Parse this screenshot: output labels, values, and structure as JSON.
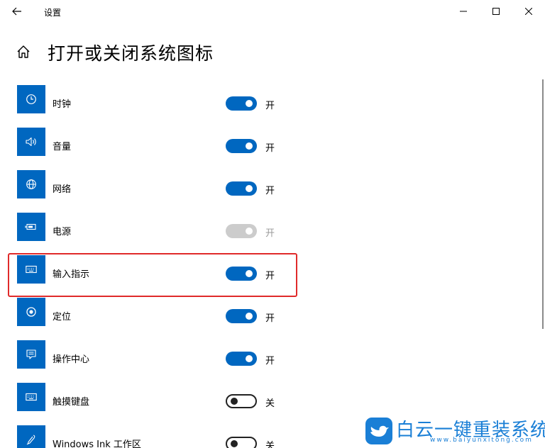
{
  "window": {
    "title": "设置"
  },
  "page": {
    "title": "打开或关闭系统图标"
  },
  "items": [
    {
      "label": "时钟",
      "icon": "clock-icon",
      "state": "on",
      "state_label": "开"
    },
    {
      "label": "音量",
      "icon": "volume-icon",
      "state": "on",
      "state_label": "开"
    },
    {
      "label": "网络",
      "icon": "globe-icon",
      "state": "on",
      "state_label": "开"
    },
    {
      "label": "电源",
      "icon": "battery-icon",
      "state": "disabled",
      "state_label": "开"
    },
    {
      "label": "输入指示",
      "icon": "keyboard-icon",
      "state": "on",
      "state_label": "开"
    },
    {
      "label": "定位",
      "icon": "location-icon",
      "state": "on",
      "state_label": "开"
    },
    {
      "label": "操作中心",
      "icon": "action-center-icon",
      "state": "on",
      "state_label": "开"
    },
    {
      "label": "触摸键盘",
      "icon": "keyboard-icon",
      "state": "off",
      "state_label": "关"
    },
    {
      "label": "Windows Ink 工作区",
      "icon": "pen-icon",
      "state": "off",
      "state_label": "关"
    }
  ],
  "watermark": {
    "text": "白云一键重装系统",
    "url": "www.baiyunxitong.com"
  },
  "colors": {
    "accent": "#0067c0",
    "highlight": "#e02a2a",
    "watermark": "#1a7fd6"
  }
}
